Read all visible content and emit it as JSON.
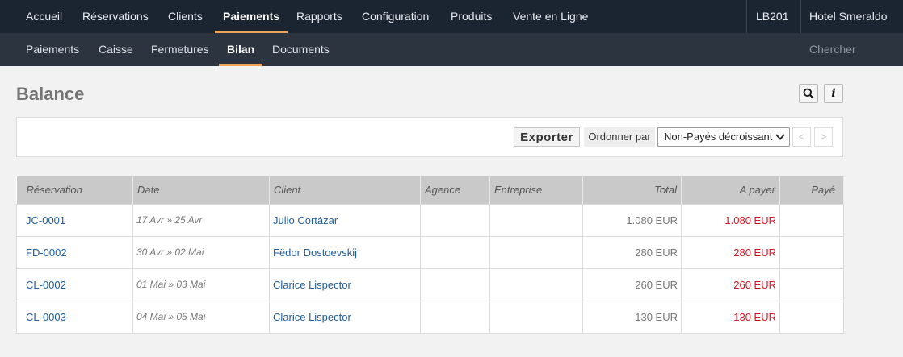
{
  "topnav": {
    "items": [
      {
        "label": "Accueil"
      },
      {
        "label": "Réservations"
      },
      {
        "label": "Clients"
      },
      {
        "label": "Paiements"
      },
      {
        "label": "Rapports"
      },
      {
        "label": "Configuration"
      },
      {
        "label": "Produits"
      },
      {
        "label": "Vente en Ligne"
      }
    ],
    "active_index": 3,
    "user_code": "LB201",
    "hotel_name": "Hotel Smeraldo"
  },
  "subnav": {
    "items": [
      {
        "label": "Paiements"
      },
      {
        "label": "Caisse"
      },
      {
        "label": "Fermetures"
      },
      {
        "label": "Bilan"
      },
      {
        "label": "Documents"
      }
    ],
    "active_index": 3,
    "search_placeholder": "Chercher"
  },
  "page": {
    "title": "Balance",
    "search_icon": "search-icon",
    "info_icon": "info-icon",
    "info_glyph": "i"
  },
  "toolbar": {
    "export_label": "Exporter",
    "sort_label": "Ordonner par",
    "sort_value": "Non-Payés décroissant",
    "prev_label": "<",
    "next_label": ">"
  },
  "table": {
    "headers": {
      "reservation": "Réservation",
      "date": "Date",
      "client": "Client",
      "agency": "Agence",
      "company": "Entreprise",
      "total": "Total",
      "due": "A payer",
      "paid": "Payé"
    },
    "rows": [
      {
        "reservation": "JC-0001",
        "date": "17 Avr » 25 Avr",
        "client": "Julio Cortázar",
        "agency": "",
        "company": "",
        "total": "1.080 EUR",
        "due": "1.080 EUR",
        "paid": ""
      },
      {
        "reservation": "FD-0002",
        "date": "30 Avr » 02 Mai",
        "client": "Fëdor Dostoevskij",
        "agency": "",
        "company": "",
        "total": "280 EUR",
        "due": "280 EUR",
        "paid": ""
      },
      {
        "reservation": "CL-0002",
        "date": "01 Mai » 03 Mai",
        "client": "Clarice Lispector",
        "agency": "",
        "company": "",
        "total": "260 EUR",
        "due": "260 EUR",
        "paid": ""
      },
      {
        "reservation": "CL-0003",
        "date": "04 Mai » 05 Mai",
        "client": "Clarice Lispector",
        "agency": "",
        "company": "",
        "total": "130 EUR",
        "due": "130 EUR",
        "paid": ""
      }
    ]
  },
  "colors": {
    "topnav_bg": "#1b2431",
    "subnav_bg": "#2c3440",
    "accent": "#f0a458",
    "link": "#1f5c99",
    "due": "#e0101e"
  }
}
